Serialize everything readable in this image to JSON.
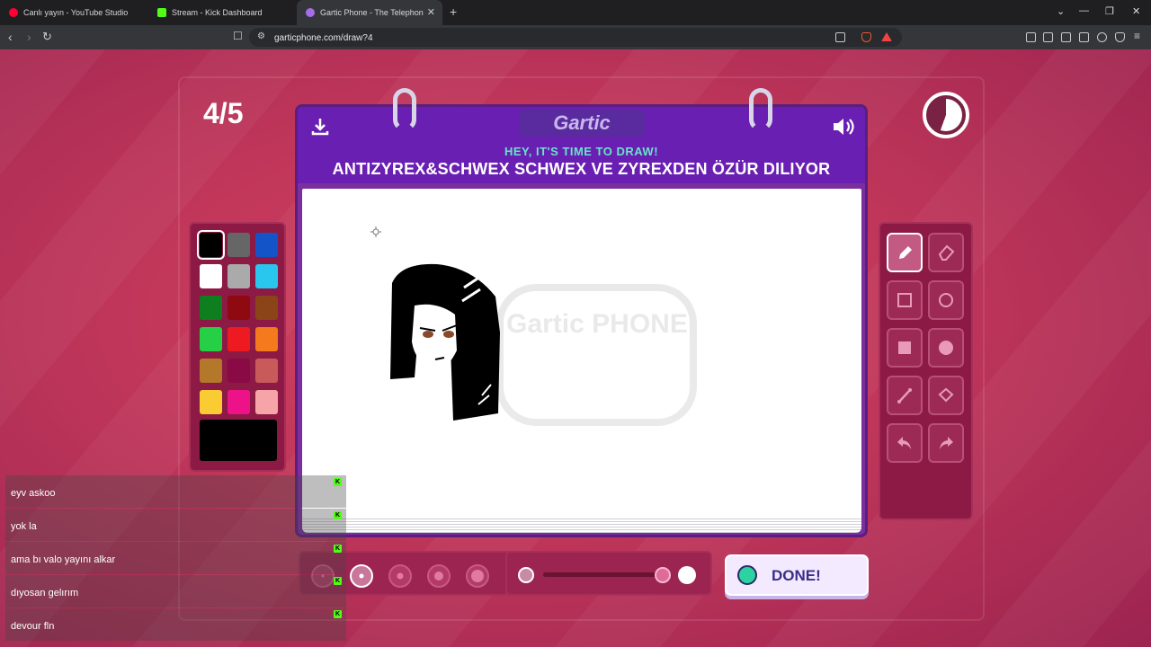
{
  "browser": {
    "tabs": [
      {
        "title": "Canlı yayın - YouTube Studio",
        "color": "#ff0033"
      },
      {
        "title": "Stream - Kick Dashboard",
        "color": "#53fc18"
      },
      {
        "title": "Gartic Phone - The Telephone G",
        "color": "#a56ee8"
      }
    ],
    "url": "garticphone.com/draw?4"
  },
  "game": {
    "round": "4/5",
    "logo": "Gartic",
    "hint": "HEY, IT'S TIME TO DRAW!",
    "prompt": "ANTIZYREX&SCHWEX SCHWEX VE ZYREXDEN ÖZÜR DILIYOR",
    "watermark": "Gartic PHONE",
    "done_label": "DONE!"
  },
  "palette": {
    "colors": [
      "#000000",
      "#666666",
      "#1354c8",
      "#ffffff",
      "#aaaaaa",
      "#29c6ee",
      "#0e7f1f",
      "#8e0a10",
      "#8a4418",
      "#25d046",
      "#ee1a22",
      "#f5791d",
      "#b4782a",
      "#8a0a45",
      "#c85a5a",
      "#f9cc33",
      "#ee1289",
      "#f6a4a8"
    ],
    "selected_color": "#000000"
  },
  "tools": [
    "pen-icon",
    "eraser-icon",
    "rectangle-outline-icon",
    "circle-outline-icon",
    "rectangle-fill-icon",
    "circle-fill-icon",
    "line-icon",
    "bucket-icon",
    "undo-icon",
    "redo-icon"
  ],
  "brush": {
    "selected_size_index": 1,
    "opacity": 1.0
  },
  "chat": [
    {
      "message": "eyv askoo"
    },
    {
      "message": "yok la"
    },
    {
      "message": "ama bı valo yayını alkar"
    },
    {
      "message": "dıyosan gelırım"
    },
    {
      "message": "devour fln"
    }
  ]
}
